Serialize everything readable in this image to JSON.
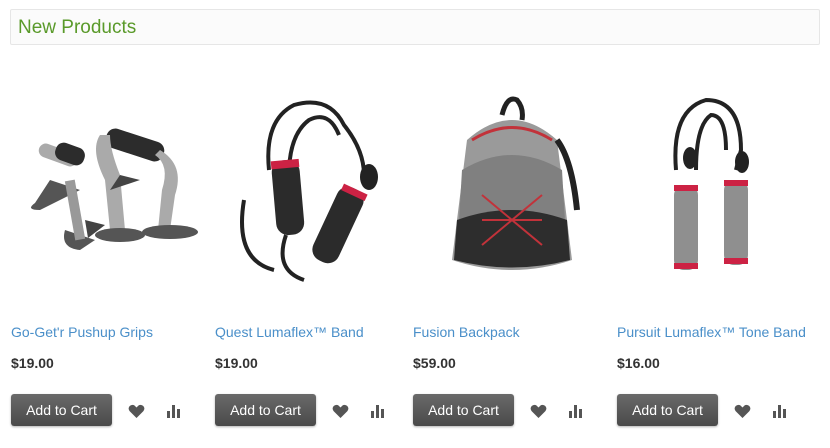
{
  "section": {
    "title": "New Products"
  },
  "colors": {
    "accent": "#5a9a2a",
    "link": "#4a8fc9",
    "button": "#555555"
  },
  "products": [
    {
      "name": "Go-Get'r Pushup Grips",
      "price": "$19.00",
      "cart_label": "Add to Cart",
      "image": "pushup-grips-image"
    },
    {
      "name": "Quest Lumaflex™ Band",
      "price": "$19.00",
      "cart_label": "Add to Cart",
      "image": "lumaflex-band-image"
    },
    {
      "name": "Fusion Backpack",
      "price": "$59.00",
      "cart_label": "Add to Cart",
      "image": "backpack-image"
    },
    {
      "name": "Pursuit Lumaflex™ Tone Band",
      "price": "$16.00",
      "cart_label": "Add to Cart",
      "image": "tone-band-image"
    }
  ],
  "icons": {
    "wishlist": "heart-icon",
    "compare": "bar-chart-icon"
  }
}
